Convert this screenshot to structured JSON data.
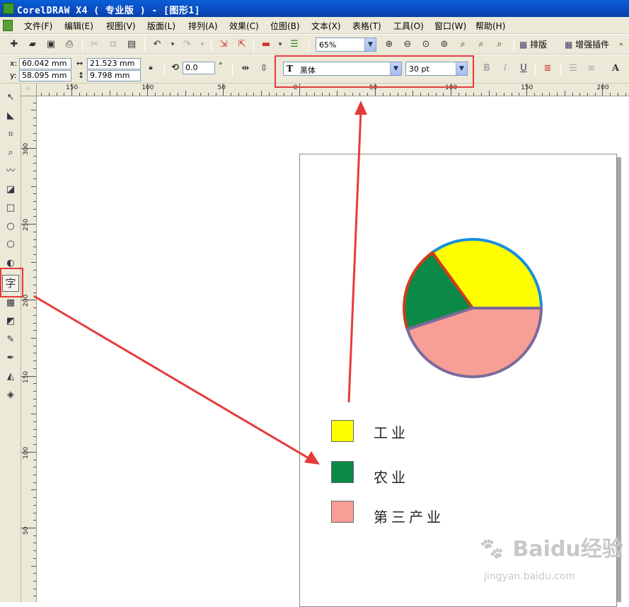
{
  "window": {
    "title": "CorelDRAW X4 ( 专业版 ) - [图形1]"
  },
  "menu": {
    "items": [
      "文件(F)",
      "编辑(E)",
      "视图(V)",
      "版面(L)",
      "排列(A)",
      "效果(C)",
      "位图(B)",
      "文本(X)",
      "表格(T)",
      "工具(O)",
      "窗口(W)",
      "帮助(H)"
    ]
  },
  "toolbar": {
    "zoom": "65%",
    "arrange_label": "排版",
    "plugin_label": "增强插件"
  },
  "property_bar": {
    "x_label": "x:",
    "x_value": "60.042 mm",
    "y_label": "y:",
    "y_value": "58.095 mm",
    "width_value": "21.523 mm",
    "height_value": "9.798 mm",
    "rotation_value": "0.0",
    "degree_symbol": "°",
    "font_name": "黑体",
    "font_size": "30 pt"
  },
  "rulers": {
    "horizontal": [
      "150",
      "100",
      "50",
      "0",
      "50",
      "100",
      "150",
      "200"
    ],
    "vertical": [
      "300",
      "250",
      "200",
      "150",
      "100",
      "50"
    ]
  },
  "colors": {
    "accent_red": "#e53b3b",
    "industry": "#ffff00",
    "agriculture": "#0b8a47",
    "tertiary": "#f79e96"
  },
  "chart_data": {
    "type": "pie",
    "categories": [
      "工业",
      "农业",
      "第三产业"
    ],
    "values": [
      0.35,
      0.2,
      0.45
    ],
    "colors": [
      "#ffff00",
      "#0b8a47",
      "#f79e96"
    ],
    "outline_colors": [
      "#1a8fdc",
      "#d23b1a",
      "#7b6a9a"
    ]
  },
  "legend": {
    "items": [
      "工业",
      "农业",
      "第三产业"
    ]
  },
  "watermark": {
    "brand": "Baidu经验",
    "url": "jingyan.baidu.com"
  }
}
